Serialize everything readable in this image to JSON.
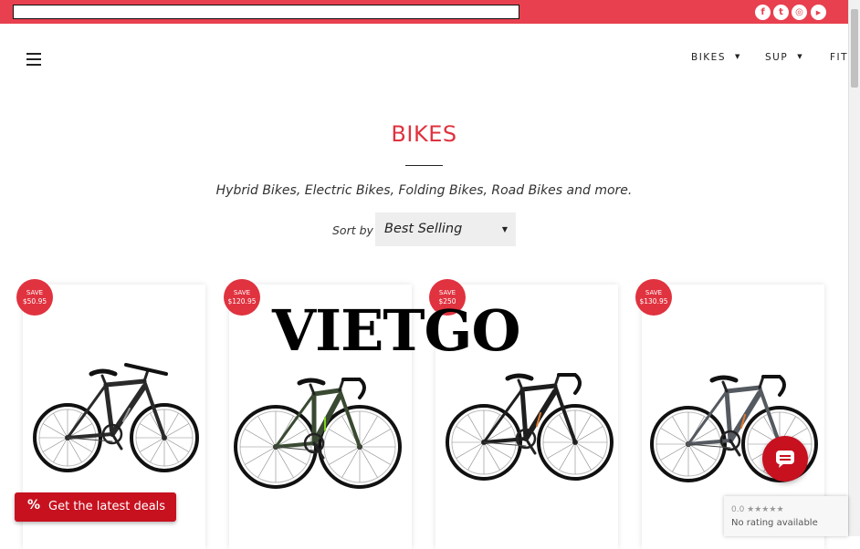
{
  "colors": {
    "accent": "#e0323f",
    "topbar": "#e8404f",
    "deals": "#c7111f"
  },
  "topbar": {
    "search_value": "",
    "social": [
      {
        "icon": "facebook-icon",
        "glyph": "f"
      },
      {
        "icon": "twitter-icon",
        "glyph": "t"
      },
      {
        "icon": "instagram-icon",
        "glyph": "◎"
      },
      {
        "icon": "youtube-icon",
        "glyph": "▶"
      }
    ]
  },
  "nav": {
    "menu_icon": "hamburger-icon",
    "items": [
      {
        "label": "BIKES"
      },
      {
        "label": "SUP"
      },
      {
        "label": "FITN"
      }
    ]
  },
  "page": {
    "title": "BIKES",
    "subtitle": "Hybrid Bikes, Electric Bikes, Folding Bikes, Road Bikes and more.",
    "sort_label": "Sort by",
    "sort_value": "Best Selling"
  },
  "products": [
    {
      "save_label": "SAVE",
      "save_amount": "$50.95",
      "bike_color": "#2a2a2a",
      "accent": "#9a9a9a"
    },
    {
      "save_label": "SAVE",
      "save_amount": "$120.95",
      "bike_color": "#3a4a32",
      "accent": "#7ed321"
    },
    {
      "save_label": "SAVE",
      "save_amount": "$250",
      "bike_color": "#1e1e1e",
      "accent": "#e07a2e"
    },
    {
      "save_label": "SAVE",
      "save_amount": "$130.95",
      "bike_color": "#555a60",
      "accent": "#e07a2e"
    }
  ],
  "watermark": "VIETGO",
  "deals_button": {
    "icon": "percent-icon",
    "label": "Get the latest deals"
  },
  "chat_button": {
    "icon": "chat-icon"
  },
  "rating_badge": {
    "score": "0.0 ★★★★★",
    "text": "No rating available"
  }
}
